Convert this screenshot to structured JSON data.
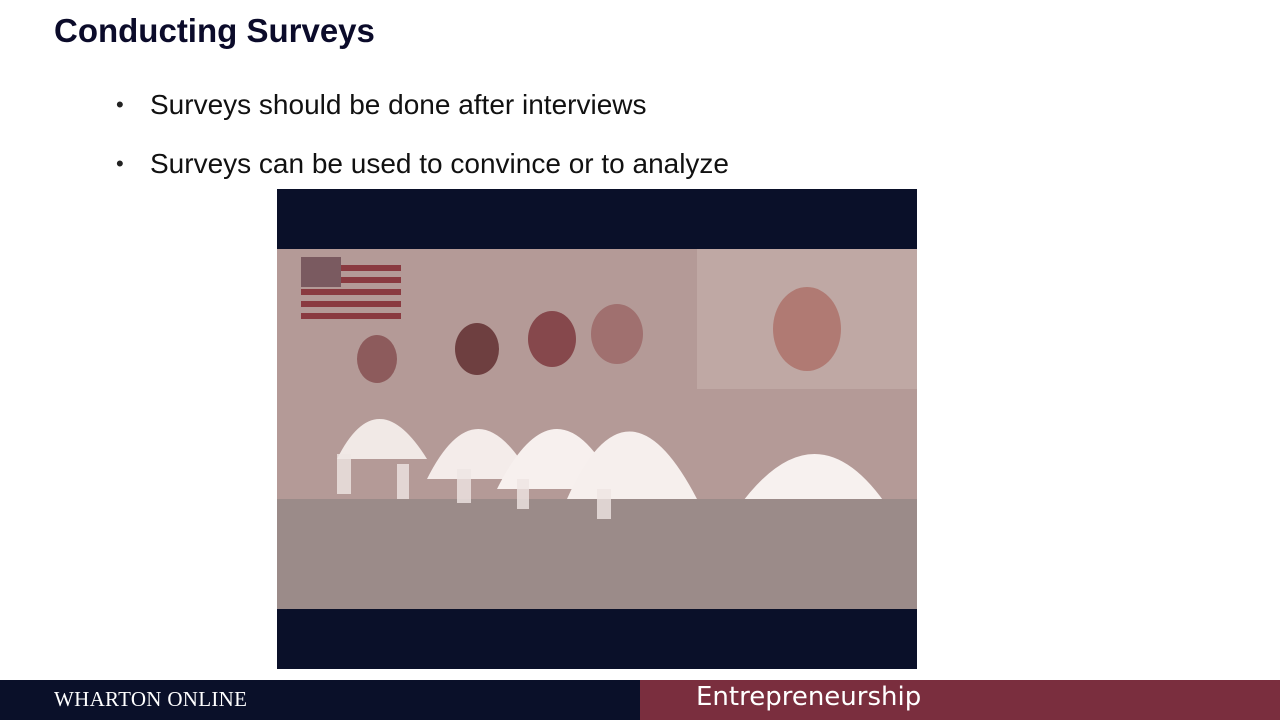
{
  "slide": {
    "title": "Conducting Surveys",
    "bullets": [
      {
        "text": "Surveys should be done after interviews"
      },
      {
        "text": "Surveys can be used to convince or to analyze"
      }
    ],
    "bullet_glyph": "•"
  },
  "video": {
    "icon": "video-still-panel-of-people-at-table"
  },
  "footer": {
    "brand": "WHARTON ONLINE",
    "course": "Entrepreneurship",
    "colors": {
      "left": "#0a1029",
      "right": "#7a2e3e"
    }
  }
}
